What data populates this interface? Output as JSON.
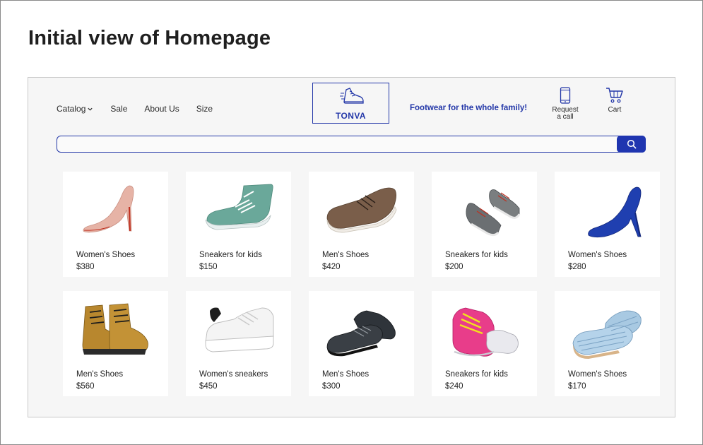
{
  "page_title": "Initial view of Homepage",
  "nav": [
    {
      "label": "Catalog",
      "has_dropdown": true
    },
    {
      "label": "Sale"
    },
    {
      "label": "About Us"
    },
    {
      "label": "Size"
    }
  ],
  "logo": {
    "text": "TONVA",
    "icon": "running-shoe-icon"
  },
  "tagline": "Footwear for the whole family!",
  "request_call": {
    "line1": "Request",
    "line2": "a call",
    "icon": "phone-icon"
  },
  "cart": {
    "label": "Cart",
    "icon": "cart-icon"
  },
  "search": {
    "placeholder": "",
    "value": "",
    "icon": "search-icon"
  },
  "colors": {
    "brand": "#2337a8",
    "button": "#1f35b0",
    "panel": "#f6f6f6"
  },
  "products": [
    {
      "name": "Women's Shoes",
      "price": "$380",
      "image": "pink-stiletto-heel"
    },
    {
      "name": "Sneakers for kids",
      "price": "$150",
      "image": "teal-high-top-sneaker"
    },
    {
      "name": "Men's Shoes",
      "price": "$420",
      "image": "brown-leather-shoe"
    },
    {
      "name": "Sneakers for kids",
      "price": "$200",
      "image": "grey-kids-sneakers-pair"
    },
    {
      "name": "Women's Shoes",
      "price": "$280",
      "image": "blue-suede-heel"
    },
    {
      "name": "Men's Shoes",
      "price": "$560",
      "image": "tan-lace-up-boots"
    },
    {
      "name": "Women's sneakers",
      "price": "$450",
      "image": "white-platform-sneaker"
    },
    {
      "name": "Men's Shoes",
      "price": "$300",
      "image": "black-leather-shoes-pair"
    },
    {
      "name": "Sneakers for kids",
      "price": "$240",
      "image": "pink-yellow-sneakers"
    },
    {
      "name": "Women's Shoes",
      "price": "$170",
      "image": "striped-ballet-flats"
    }
  ]
}
